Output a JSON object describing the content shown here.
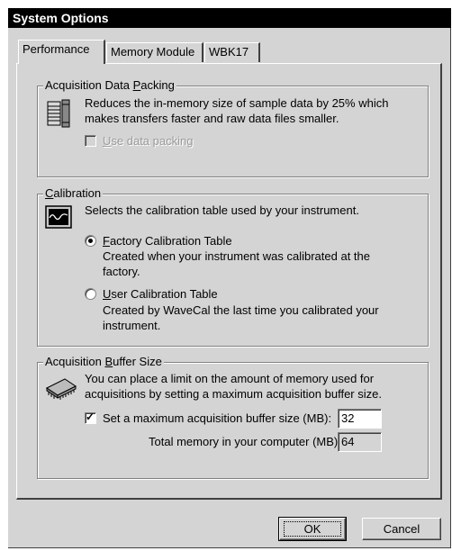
{
  "window": {
    "title": "System Options"
  },
  "tabs": [
    "Performance",
    "Memory Module",
    "WBK17"
  ],
  "packing": {
    "legend_pre": "Acquisition Data ",
    "legend_key": "P",
    "legend_post": "acking",
    "desc1": "Reduces the in-memory size of sample data by 25% which",
    "desc2": "makes transfers faster and raw data files smaller.",
    "checkbox_key": "U",
    "checkbox_rest": "se data packing"
  },
  "calibration": {
    "legend_key": "C",
    "legend_rest": "alibration",
    "desc": "Selects the calibration table used by your instrument.",
    "factory_key": "F",
    "factory_rest": "actory Calibration Table",
    "factory_desc1": "Created when your instrument was calibrated at the",
    "factory_desc2": "factory.",
    "user_key": "U",
    "user_rest": "ser Calibration Table",
    "user_desc1": "Created by WaveCal the last time you calibrated your",
    "user_desc2": "instrument."
  },
  "buffer": {
    "legend_pre": "Acquisition ",
    "legend_key": "B",
    "legend_post": "uffer Size",
    "desc1": "You can place a limit on the amount of memory used for",
    "desc2": "acquisitions by setting a maximum acquisition buffer size.",
    "checkbox_label": "Set a maximum acquisition buffer size (MB):",
    "max_value": "32",
    "total_label": "Total memory in your computer (MB):",
    "total_value": "64"
  },
  "buttons": {
    "ok": "OK",
    "cancel": "Cancel"
  }
}
